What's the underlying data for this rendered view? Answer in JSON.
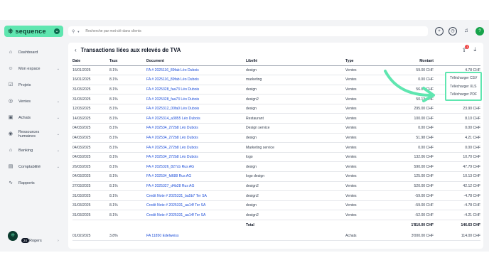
{
  "brand": {
    "name": "sequence",
    "mark": "⁜",
    "accent": "#5fe6b0"
  },
  "sidebar": {
    "items": [
      {
        "label": "Dashboard",
        "icon": "home-icon",
        "chev": ""
      },
      {
        "label": "Mon espace",
        "icon": "user-icon",
        "chev": "⌄"
      },
      {
        "label": "Projets",
        "icon": "check-square-icon",
        "chev": ""
      },
      {
        "label": "Ventes",
        "icon": "coins-icon",
        "chev": "⌄"
      },
      {
        "label": "Achats",
        "icon": "bag-icon",
        "chev": "⌄"
      },
      {
        "label": "Ressources humaines",
        "icon": "people-icon",
        "chev": "⌄"
      },
      {
        "label": "Banking",
        "icon": "bank-icon",
        "chev": "⌄"
      },
      {
        "label": "Comptabilité",
        "icon": "calculator-icon",
        "chev": "⌄"
      },
      {
        "label": "Rapports",
        "icon": "chart-icon",
        "chev": ""
      }
    ],
    "user": {
      "badge": "24",
      "label": "Rogers",
      "prefix": "..."
    }
  },
  "search": {
    "placeholder": "Recherche par mot-clé dans clients"
  },
  "page": {
    "title": "Transactions liées aux relevés de TVA",
    "notif_count": "1"
  },
  "table": {
    "headers": {
      "date": "Date",
      "taux": "Taux",
      "document": "Document",
      "libelle": "Libellé",
      "type": "Type",
      "montant": "Montant",
      "tva": ""
    },
    "rows": [
      [
        "16/01/2025",
        "8.1%",
        "FA # 2025116_89fab Léo Dubois",
        "design",
        "Ventes",
        "59.00 CHF",
        "4.78 CHF"
      ],
      [
        "16/01/2025",
        "8.1%",
        "FA # 2025116_89fab Léo Dubois",
        "marketing",
        "Ventes",
        "0.00 CHF",
        "0.00 CHF"
      ],
      [
        "31/03/2025",
        "8.1%",
        "FA # 2025328_faa73 Léo Dubois",
        "design",
        "Ventes",
        "56.87 CHF",
        "4.61 CHF"
      ],
      [
        "31/03/2025",
        "8.1%",
        "FA # 2025328_faa73 Léo Dubois",
        "design2",
        "Ventes",
        "50.13 CHF",
        "4.06 CHF"
      ],
      [
        "12/03/2025",
        "8.1%",
        "FA # 2025312_00fa0 Léo Dubois",
        "design",
        "Ventes",
        "295.00 CHF",
        "23.90 CHF"
      ],
      [
        "14/03/2025",
        "8.1%",
        "FA # 2025314_a3855 Léo Dubois",
        "Restaurant",
        "Ventes",
        "100.00 CHF",
        "8.10 CHF"
      ],
      [
        "04/03/2025",
        "8.1%",
        "FA # 202534_272b8 Léo Dubois",
        "Design service",
        "Ventes",
        "0.00 CHF",
        "0.00 CHF"
      ],
      [
        "04/03/2025",
        "8.1%",
        "FA # 202534_272b8 Léo Dubois",
        "design",
        "Ventes",
        "51.98 CHF",
        "4.21 CHF"
      ],
      [
        "04/03/2025",
        "8.1%",
        "FA # 202534_272b8 Léo Dubois",
        "Marketing service",
        "Ventes",
        "0.00 CHF",
        "0.00 CHF"
      ],
      [
        "04/03/2025",
        "8.1%",
        "FA # 202534_272b8 Léo Dubois",
        "logo",
        "Ventes",
        "132.06 CHF",
        "10.70 CHF"
      ],
      [
        "26/03/2025",
        "8.1%",
        "FA # 2025326_827cb Rus AG",
        "design",
        "Ventes",
        "590.00 CHF",
        "47.79 CHF"
      ],
      [
        "04/03/2025",
        "8.1%",
        "FA # 202534_fd688 Rus AG",
        "logo design",
        "Ventes",
        "125.00 CHF",
        "10.13 CHF"
      ],
      [
        "27/03/2025",
        "8.1%",
        "FA # 2025327_d4b28 Rus AG",
        "design2",
        "Ventes",
        "520.00 CHF",
        "42.12 CHF"
      ],
      [
        "31/03/2025",
        "8.1%",
        "Credit Note # 2025331_ba5b7 Ter SA",
        "design2",
        "Ventes",
        "-59.00 CHF",
        "-4.78 CHF"
      ],
      [
        "31/03/2025",
        "8.1%",
        "Credit Note # 2025331_aa14f Ter SA",
        "design",
        "Ventes",
        "-59.00 CHF",
        "-4.78 CHF"
      ],
      [
        "31/03/2025",
        "8.1%",
        "Credit Note # 2025331_aa14f Ter SA",
        "design2",
        "Ventes",
        "-52.00 CHF",
        "-4.21 CHF"
      ]
    ],
    "total": {
      "label": "Total",
      "montant": "1'810.00 CHF",
      "tva": "146.63 CHF"
    }
  },
  "table2": {
    "rows": [
      [
        "01/02/2025",
        "3.8%",
        "FA 11850 Edelweiss",
        "",
        "Achats",
        "3'000.00 CHF",
        "114.00 CHF"
      ]
    ]
  },
  "download_menu": {
    "options": [
      "Télécharger CSV",
      "Télécharger XLS",
      "Télécharger PDF"
    ]
  }
}
